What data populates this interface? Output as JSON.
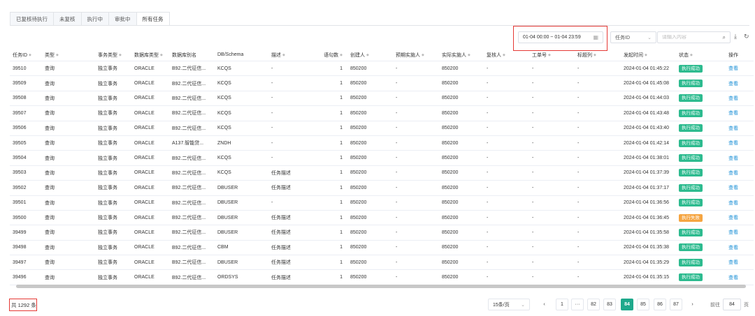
{
  "tabs": [
    {
      "label": "已复核待执行",
      "active": false
    },
    {
      "label": "未复核",
      "active": false
    },
    {
      "label": "执行中",
      "active": false
    },
    {
      "label": "审批中",
      "active": false
    },
    {
      "label": "所有任务",
      "active": true
    }
  ],
  "filters": {
    "date_range": "01-04 00:00 ~ 01-04 23:59",
    "field_select": "任务ID",
    "search_placeholder": "请输入内容",
    "search_icon": "search-icon",
    "download_icon": "download-icon",
    "refresh_icon": "refresh-icon",
    "calendar_icon": "calendar-icon"
  },
  "table": {
    "headers": [
      "任务ID",
      "类型",
      "事务类型",
      "数据库类型",
      "数据库别名",
      "DB/Schema",
      "描述",
      "语句数",
      "创建人",
      "预期实施人",
      "实际实施人",
      "复核人",
      "工单号",
      "标题列",
      "发起时间",
      "状态",
      "操作"
    ],
    "rows": [
      {
        "id": "39510",
        "type": "查询",
        "tx": "独立事务",
        "dbtype": "ORACLE",
        "alias": "B92.二代征信...",
        "schema": "KCQS",
        "desc": "-",
        "count": "1",
        "creator": "850200",
        "expected": "-",
        "actual": "850200",
        "reviewer": "-",
        "ticket": "-",
        "title": "-",
        "time": "2024-01-04 01:45:22",
        "status": "执行成功",
        "status_color": "#2dbb8f",
        "action": "查看"
      },
      {
        "id": "39509",
        "type": "查询",
        "tx": "独立事务",
        "dbtype": "ORACLE",
        "alias": "B92.二代征信...",
        "schema": "KCQS",
        "desc": "-",
        "count": "1",
        "creator": "850200",
        "expected": "-",
        "actual": "850200",
        "reviewer": "-",
        "ticket": "-",
        "title": "-",
        "time": "2024-01-04 01:45:08",
        "status": "执行成功",
        "status_color": "#2dbb8f",
        "action": "查看"
      },
      {
        "id": "39508",
        "type": "查询",
        "tx": "独立事务",
        "dbtype": "ORACLE",
        "alias": "B92.二代征信...",
        "schema": "KCQS",
        "desc": "-",
        "count": "1",
        "creator": "850200",
        "expected": "-",
        "actual": "850200",
        "reviewer": "-",
        "ticket": "-",
        "title": "-",
        "time": "2024-01-04 01:44:03",
        "status": "执行成功",
        "status_color": "#2dbb8f",
        "action": "查看"
      },
      {
        "id": "39507",
        "type": "查询",
        "tx": "独立事务",
        "dbtype": "ORACLE",
        "alias": "B92.二代征信...",
        "schema": "KCQS",
        "desc": "-",
        "count": "1",
        "creator": "850200",
        "expected": "-",
        "actual": "850200",
        "reviewer": "-",
        "ticket": "-",
        "title": "-",
        "time": "2024-01-04 01:43:48",
        "status": "执行成功",
        "status_color": "#2dbb8f",
        "action": "查看"
      },
      {
        "id": "39506",
        "type": "查询",
        "tx": "独立事务",
        "dbtype": "ORACLE",
        "alias": "B92.二代征信...",
        "schema": "KCQS",
        "desc": "-",
        "count": "1",
        "creator": "850200",
        "expected": "-",
        "actual": "850200",
        "reviewer": "-",
        "ticket": "-",
        "title": "-",
        "time": "2024-01-04 01:43:40",
        "status": "执行成功",
        "status_color": "#2dbb8f",
        "action": "查看"
      },
      {
        "id": "39505",
        "type": "查询",
        "tx": "独立事务",
        "dbtype": "ORACLE",
        "alias": "A137.智能贷...",
        "schema": "ZNDH",
        "desc": "-",
        "count": "1",
        "creator": "850200",
        "expected": "-",
        "actual": "850200",
        "reviewer": "-",
        "ticket": "-",
        "title": "-",
        "time": "2024-01-04 01:42:14",
        "status": "执行成功",
        "status_color": "#2dbb8f",
        "action": "查看"
      },
      {
        "id": "39504",
        "type": "查询",
        "tx": "独立事务",
        "dbtype": "ORACLE",
        "alias": "B92.二代征信...",
        "schema": "KCQS",
        "desc": "-",
        "count": "1",
        "creator": "850200",
        "expected": "-",
        "actual": "850200",
        "reviewer": "-",
        "ticket": "-",
        "title": "-",
        "time": "2024-01-04 01:38:01",
        "status": "执行成功",
        "status_color": "#2dbb8f",
        "action": "查看"
      },
      {
        "id": "39503",
        "type": "查询",
        "tx": "独立事务",
        "dbtype": "ORACLE",
        "alias": "B92.二代征信...",
        "schema": "KCQS",
        "desc": "任务描述",
        "count": "1",
        "creator": "850200",
        "expected": "-",
        "actual": "850200",
        "reviewer": "-",
        "ticket": "-",
        "title": "-",
        "time": "2024-01-04 01:37:39",
        "status": "执行成功",
        "status_color": "#2dbb8f",
        "action": "查看"
      },
      {
        "id": "39502",
        "type": "查询",
        "tx": "独立事务",
        "dbtype": "ORACLE",
        "alias": "B92.二代征信...",
        "schema": "DBUSER",
        "desc": "任务描述",
        "count": "1",
        "creator": "850200",
        "expected": "-",
        "actual": "850200",
        "reviewer": "-",
        "ticket": "-",
        "title": "-",
        "time": "2024-01-04 01:37:17",
        "status": "执行成功",
        "status_color": "#2dbb8f",
        "action": "查看"
      },
      {
        "id": "39501",
        "type": "查询",
        "tx": "独立事务",
        "dbtype": "ORACLE",
        "alias": "B92.二代征信...",
        "schema": "DBUSER",
        "desc": "-",
        "count": "1",
        "creator": "850200",
        "expected": "-",
        "actual": "850200",
        "reviewer": "-",
        "ticket": "-",
        "title": "-",
        "time": "2024-01-04 01:36:56",
        "status": "执行成功",
        "status_color": "#2dbb8f",
        "action": "查看"
      },
      {
        "id": "39500",
        "type": "查询",
        "tx": "独立事务",
        "dbtype": "ORACLE",
        "alias": "B92.二代征信...",
        "schema": "DBUSER",
        "desc": "任务描述",
        "count": "1",
        "creator": "850200",
        "expected": "-",
        "actual": "850200",
        "reviewer": "-",
        "ticket": "-",
        "title": "-",
        "time": "2024-01-04 01:36:45",
        "status": "执行失败",
        "status_color": "#f5a542",
        "action": "查看"
      },
      {
        "id": "39499",
        "type": "查询",
        "tx": "独立事务",
        "dbtype": "ORACLE",
        "alias": "B92.二代征信...",
        "schema": "DBUSER",
        "desc": "任务描述",
        "count": "1",
        "creator": "850200",
        "expected": "-",
        "actual": "850200",
        "reviewer": "-",
        "ticket": "-",
        "title": "-",
        "time": "2024-01-04 01:35:58",
        "status": "执行成功",
        "status_color": "#2dbb8f",
        "action": "查看"
      },
      {
        "id": "39498",
        "type": "查询",
        "tx": "独立事务",
        "dbtype": "ORACLE",
        "alias": "B92.二代征信...",
        "schema": "CBM",
        "desc": "任务描述",
        "count": "1",
        "creator": "850200",
        "expected": "-",
        "actual": "850200",
        "reviewer": "-",
        "ticket": "-",
        "title": "-",
        "time": "2024-01-04 01:35:38",
        "status": "执行成功",
        "status_color": "#2dbb8f",
        "action": "查看"
      },
      {
        "id": "39497",
        "type": "查询",
        "tx": "独立事务",
        "dbtype": "ORACLE",
        "alias": "B92.二代征信...",
        "schema": "DBUSER",
        "desc": "任务描述",
        "count": "1",
        "creator": "850200",
        "expected": "-",
        "actual": "850200",
        "reviewer": "-",
        "ticket": "-",
        "title": "-",
        "time": "2024-01-04 01:35:29",
        "status": "执行成功",
        "status_color": "#2dbb8f",
        "action": "查看"
      },
      {
        "id": "39496",
        "type": "查询",
        "tx": "独立事务",
        "dbtype": "ORACLE",
        "alias": "B92.二代征信...",
        "schema": "ORDSYS",
        "desc": "任务描述",
        "count": "1",
        "creator": "850200",
        "expected": "-",
        "actual": "850200",
        "reviewer": "-",
        "ticket": "-",
        "title": "-",
        "time": "2024-01-04 01:35:15",
        "status": "执行成功",
        "status_color": "#2dbb8f",
        "action": "查看"
      }
    ]
  },
  "footer": {
    "total": "共 1292 条",
    "page_size": "15条/页",
    "pages": [
      "1",
      "···",
      "82",
      "83",
      "84",
      "85",
      "86",
      "87"
    ],
    "current_page": "84",
    "goto_label": "前往",
    "goto_value": "84",
    "goto_suffix": "页"
  },
  "colors": {
    "accent": "#1fa98c",
    "success": "#2dbb8f",
    "failure": "#f5a542",
    "link": "#1a8fd6",
    "highlight": "#e53935"
  }
}
